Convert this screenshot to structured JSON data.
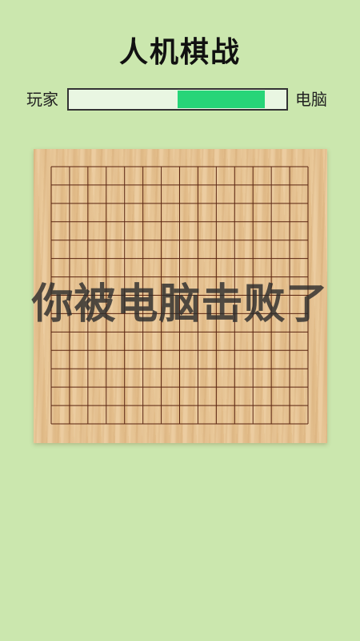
{
  "header": {
    "title": "人机棋战"
  },
  "score": {
    "player_label": "玩家",
    "computer_label": "电脑",
    "bar_fill_start": 0.5,
    "bar_fill_end": 0.9,
    "fill_color": "#27d578",
    "track_color": "#e9f6e2"
  },
  "board": {
    "grid_size": 15,
    "line_color": "#5a2410",
    "wood_color": "#e6c18e"
  },
  "result": {
    "message": "你被电脑击败了"
  },
  "colors": {
    "background": "#cbe7ae"
  }
}
